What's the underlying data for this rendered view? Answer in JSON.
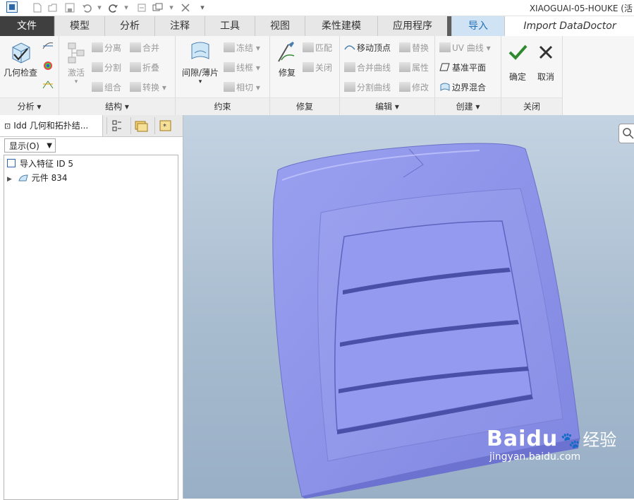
{
  "window": {
    "title": "XIAOGUAI-05-HOUKE (活"
  },
  "tabs": [
    {
      "label": "文件"
    },
    {
      "label": "模型"
    },
    {
      "label": "分析"
    },
    {
      "label": "注释"
    },
    {
      "label": "工具"
    },
    {
      "label": "视图"
    },
    {
      "label": "柔性建模"
    },
    {
      "label": "应用程序"
    },
    {
      "label": "导入"
    },
    {
      "label": "Import DataDoctor"
    }
  ],
  "ribbon": {
    "analysis": {
      "label": "分析",
      "geometry_check": "几何检查"
    },
    "structure": {
      "label": "结构",
      "activate": "激活",
      "separate": "分离",
      "split": "分割",
      "group": "组合",
      "merge": "合并",
      "fold": "折叠",
      "convert": "转换"
    },
    "constraint": {
      "label": "约束",
      "gap_sheet": "间隙/薄片",
      "freeze": "冻结",
      "wireframe": "线框",
      "tangent": "相切"
    },
    "repair": {
      "label": "修复",
      "repair": "修复",
      "match": "匹配",
      "close": "关闭"
    },
    "edit": {
      "label": "编辑",
      "move_vertex": "移动顶点",
      "replace": "替换",
      "merge_curve": "合并曲线",
      "properties": "属性",
      "split_curve": "分割曲线",
      "modify": "修改"
    },
    "create": {
      "label": "创建",
      "uv_curve": "UV 曲线",
      "datum_plane": "基准平面",
      "boundary_blend": "边界混合"
    },
    "close": {
      "label": "关闭",
      "ok": "确定",
      "cancel": "取消"
    }
  },
  "left_panel": {
    "tab_title": "Idd 几何和拓扑结...",
    "show_label": "显示(O)",
    "tree": [
      {
        "label": "导入特征 ID 5"
      },
      {
        "label": "元件 834"
      }
    ]
  },
  "viewport": {
    "watermark": {
      "brand": "Baidu",
      "cn": "经验",
      "url": "jingyan.baidu.com"
    }
  },
  "colors": {
    "model": "#8f95e8",
    "accent": "#2470b8",
    "file_tab": "#3f3f3f"
  }
}
